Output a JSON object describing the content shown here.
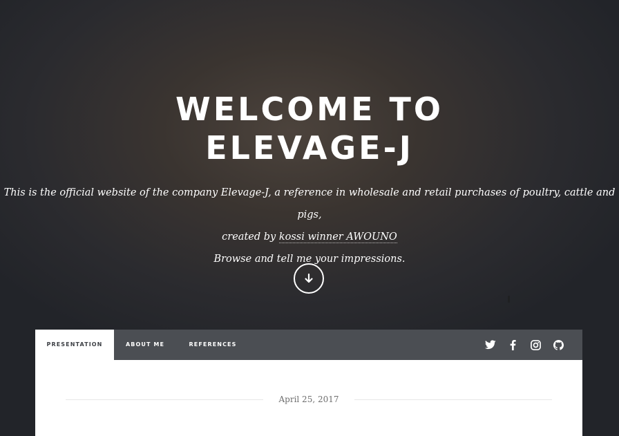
{
  "hero": {
    "title_line1": "WELCOME TO",
    "title_line2": "ELEVAGE-J",
    "intro_line1": "This is the official website of the company Elevage-J, a reference in wholesale and retail purchases of poultry, cattle and pigs,",
    "intro_line2_prefix": "created by ",
    "intro_author": "kossi winner AWOUNO",
    "intro_line3": "Browse and tell me your impressions.",
    "scroll_icon": "arrow-down-circle-icon"
  },
  "nav": {
    "tabs": [
      {
        "label": "PRESENTATION",
        "active": true
      },
      {
        "label": "ABOUT ME",
        "active": false
      },
      {
        "label": "REFERENCES",
        "active": false
      }
    ],
    "social": [
      "twitter-icon",
      "facebook-icon",
      "instagram-icon",
      "github-icon"
    ]
  },
  "post": {
    "date": "April 25, 2017"
  },
  "colors": {
    "nav_bg": "#4b4e53",
    "panel_bg": "#ffffff",
    "text_light": "#ffffff",
    "date_text": "#6e6e6e"
  }
}
